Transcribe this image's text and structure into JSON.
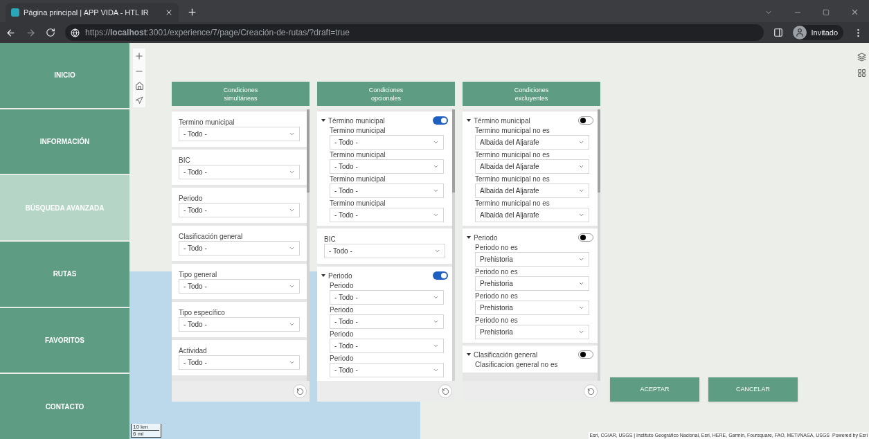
{
  "browser": {
    "tab_title": "Página principal | APP VIDA - HTL IR",
    "url": "https://**localhost**:3001/experience/7/page/Creación-de-rutas/?draft=true",
    "profile": "Invitado"
  },
  "sidebar": {
    "items": [
      {
        "label": "INICIO",
        "selected": false
      },
      {
        "label": "INFORMACIÓN",
        "selected": false
      },
      {
        "label": "BÚSQUEDA AVANZADA",
        "selected": true
      },
      {
        "label": "RUTAS",
        "selected": false
      },
      {
        "label": "FAVORITOS",
        "selected": false
      },
      {
        "label": "CONTACTO",
        "selected": false
      }
    ]
  },
  "columns": [
    {
      "title": "Condiciones\nsimultáneas",
      "sections": [
        {
          "kind": "field",
          "label": "Termino municipal",
          "value": "- Todo -"
        },
        {
          "kind": "field",
          "label": "BIC",
          "value": "- Todo -"
        },
        {
          "kind": "field",
          "label": "Periodo",
          "value": "- Todo -"
        },
        {
          "kind": "field",
          "label": "Clasificación general",
          "value": "- Todo -"
        },
        {
          "kind": "field",
          "label": "Tipo general",
          "value": "- Todo -"
        },
        {
          "kind": "field",
          "label": "Tipo específico",
          "value": "- Todo -"
        },
        {
          "kind": "field",
          "label": "Actividad",
          "value": "- Todo -"
        }
      ]
    },
    {
      "title": "Condiciones\nopcionales",
      "sections": [
        {
          "kind": "group",
          "title": "Término municipal",
          "expanded": true,
          "on": true,
          "fields": [
            {
              "label": "Termino municipal",
              "value": "- Todo -"
            },
            {
              "label": "Termino municipal",
              "value": "- Todo -"
            },
            {
              "label": "Termino municipal",
              "value": "- Todo -"
            },
            {
              "label": "Termino municipal",
              "value": "- Todo -"
            }
          ]
        },
        {
          "kind": "field",
          "label": "BIC",
          "value": "- Todo -"
        },
        {
          "kind": "group",
          "title": "Periodo",
          "expanded": true,
          "on": true,
          "fields": [
            {
              "label": "Periodo",
              "value": "- Todo -"
            },
            {
              "label": "Periodo",
              "value": "- Todo -"
            },
            {
              "label": "Periodo",
              "value": "- Todo -"
            },
            {
              "label": "Periodo",
              "value": "- Todo -"
            }
          ]
        }
      ]
    },
    {
      "title": "Condiciones\nexcluyentes",
      "sections": [
        {
          "kind": "group",
          "title": "Término municipal",
          "expanded": true,
          "on": false,
          "fields": [
            {
              "label": "Termino municipal no es",
              "value": "Albaida del Aljarafe"
            },
            {
              "label": "Termino municipal no es",
              "value": "Albaida del Aljarafe"
            },
            {
              "label": "Termino municipal no es",
              "value": "Albaida del Aljarafe"
            },
            {
              "label": "Termino municipal no es",
              "value": "Albaida del Aljarafe"
            }
          ]
        },
        {
          "kind": "group",
          "title": "Periodo",
          "expanded": true,
          "on": false,
          "fields": [
            {
              "label": "Periodo no es",
              "value": "Prehistoria"
            },
            {
              "label": "Periodo no es",
              "value": "Prehistoria"
            },
            {
              "label": "Periodo no es",
              "value": "Prehistoria"
            },
            {
              "label": "Periodo no es",
              "value": "Prehistoria"
            }
          ]
        },
        {
          "kind": "group",
          "title": "Clasificación general",
          "expanded": true,
          "on": false,
          "fields": [
            {
              "label": "Clasificacion general no es"
            }
          ]
        }
      ]
    }
  ],
  "buttons": [
    "ACEPTAR",
    "CANCELAR"
  ],
  "map": {
    "scale": [
      "10 km",
      "6 mi"
    ],
    "attribution": "Esri, CGIAR, USGS | Instituto Geográfico Nacional, Esri, HERE, Garmin, Foursquare, FAO, METI/NASA, USGS",
    "powered_by": "Powered by Esri"
  }
}
